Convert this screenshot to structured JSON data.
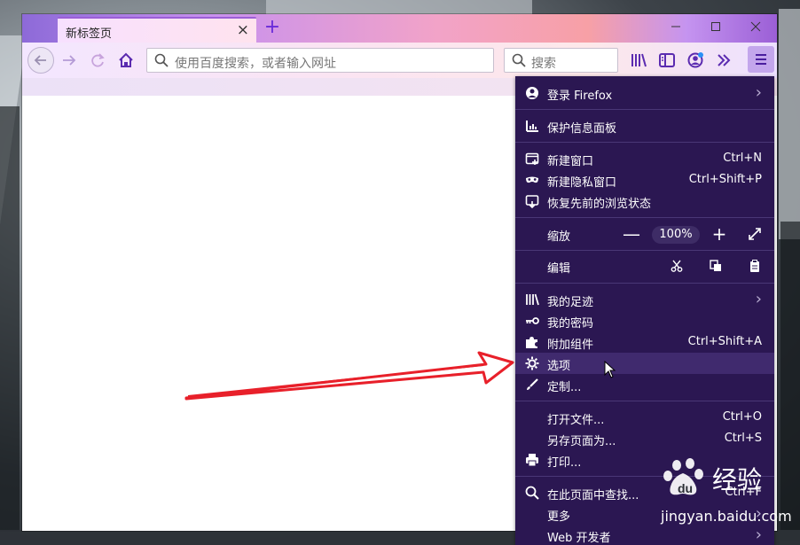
{
  "tab": {
    "title": "新标签页",
    "close": "×",
    "new_tab": "+"
  },
  "window_controls": {
    "minimize": "—",
    "maximize": "☐",
    "close": "✕"
  },
  "nav": {
    "back_icon": "arrow-left-icon",
    "forward_icon": "arrow-right-icon",
    "reload_icon": "reload-icon",
    "home_icon": "home-icon",
    "url_placeholder": "使用百度搜索，或者输入网址",
    "search_placeholder": "搜索"
  },
  "toolbar_icons": [
    "library-icon",
    "sidebar-icon",
    "account-icon",
    "overflow-icon",
    "hamburger-menu-icon"
  ],
  "menu": {
    "signin": {
      "label": "登录 Firefox"
    },
    "protections": {
      "label": "保护信息面板"
    },
    "new_window": {
      "label": "新建窗口",
      "shortcut": "Ctrl+N"
    },
    "private_window": {
      "label": "新建隐私窗口",
      "shortcut": "Ctrl+Shift+P"
    },
    "restore": {
      "label": "恢复先前的浏览状态"
    },
    "zoom": {
      "label": "缩放",
      "minus": "—",
      "value": "100%",
      "plus": "+"
    },
    "edit": {
      "label": "编辑"
    },
    "library": {
      "label": "我的足迹"
    },
    "passwords": {
      "label": "我的密码"
    },
    "addons": {
      "label": "附加组件",
      "shortcut": "Ctrl+Shift+A"
    },
    "options": {
      "label": "选项"
    },
    "customize": {
      "label": "定制..."
    },
    "open_file": {
      "label": "打开文件...",
      "shortcut": "Ctrl+O"
    },
    "save_page": {
      "label": "另存页面为...",
      "shortcut": "Ctrl+S"
    },
    "print": {
      "label": "打印..."
    },
    "find": {
      "label": "在此页面中查找...",
      "shortcut": "Ctrl+F"
    },
    "more": {
      "label": "更多"
    },
    "webdev": {
      "label": "Web 开发者"
    }
  },
  "watermark": {
    "logo": "Bai",
    "logo2": "du",
    "brand": "经验",
    "url": "jingyan.baidu.com"
  },
  "colors": {
    "menu_bg": "#2b1752",
    "accent": "#6a2bd9",
    "arrow": "#e8202a"
  }
}
